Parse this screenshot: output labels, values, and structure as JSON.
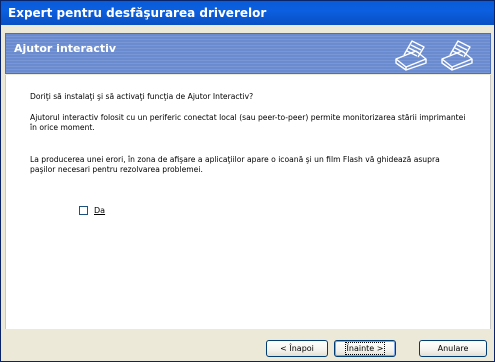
{
  "window": {
    "title": "Expert pentru desfăşurarea driverelor"
  },
  "banner": {
    "title": "Ajutor interactiv",
    "icons": [
      "printer-icon",
      "printer-icon"
    ]
  },
  "content": {
    "question": "Doriţi să instalaţi şi să activaţi funcţia de Ajutor Interactiv?",
    "paragraph1_line1": "Ajutorul interactiv folosit cu un periferic conectat local (sau peer-to-peer) permite monitorizarea stării imprimantei",
    "paragraph1_line2": "în orice moment.",
    "paragraph2_line1": "La producerea unei erori, în zona de afişare a aplicaţiilor apare o icoană şi un film Flash vă ghidează asupra",
    "paragraph2_line2": "paşilor necesari pentru rezolvarea problemei.",
    "checkbox_label": "Da",
    "checkbox_checked": false
  },
  "buttons": {
    "back": "< Înapoi",
    "next": "Înainte >",
    "cancel": "Anulare"
  },
  "colors": {
    "titlebar": "#0a5bd6",
    "banner": "#6a8bd0",
    "dialog_bg": "#ece9d8"
  }
}
